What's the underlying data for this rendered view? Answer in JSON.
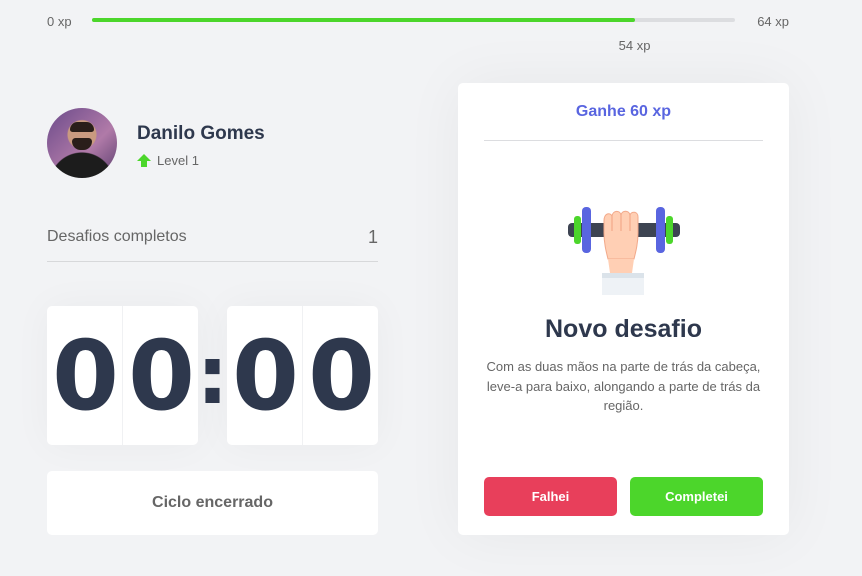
{
  "xp": {
    "min_label": "0 xp",
    "max_label": "64 xp",
    "current_label": "54 xp",
    "current": 54,
    "max": 64,
    "fill_color": "#4cd62b"
  },
  "profile": {
    "name": "Danilo Gomes",
    "level_label": "Level 1",
    "level_icon": "level-up-arrow-icon"
  },
  "completed": {
    "label": "Desafios completos",
    "value": "1"
  },
  "countdown": {
    "minute_left": "0",
    "minute_right": "0",
    "separator": ":",
    "second_left": "0",
    "second_right": "0"
  },
  "cycle_button": {
    "label": "Ciclo encerrado"
  },
  "challenge": {
    "header": "Ganhe 60 xp",
    "icon": "dumbbell-icon",
    "title": "Novo desafio",
    "description": "Com as duas mãos na parte de trás da cabeça, leve-a para baixo, alongando a parte de trás da região.",
    "failed_label": "Falhei",
    "succeeded_label": "Completei",
    "accent_color": "#5965e0",
    "failed_color": "#e83f5b",
    "succeeded_color": "#4cd62b"
  }
}
